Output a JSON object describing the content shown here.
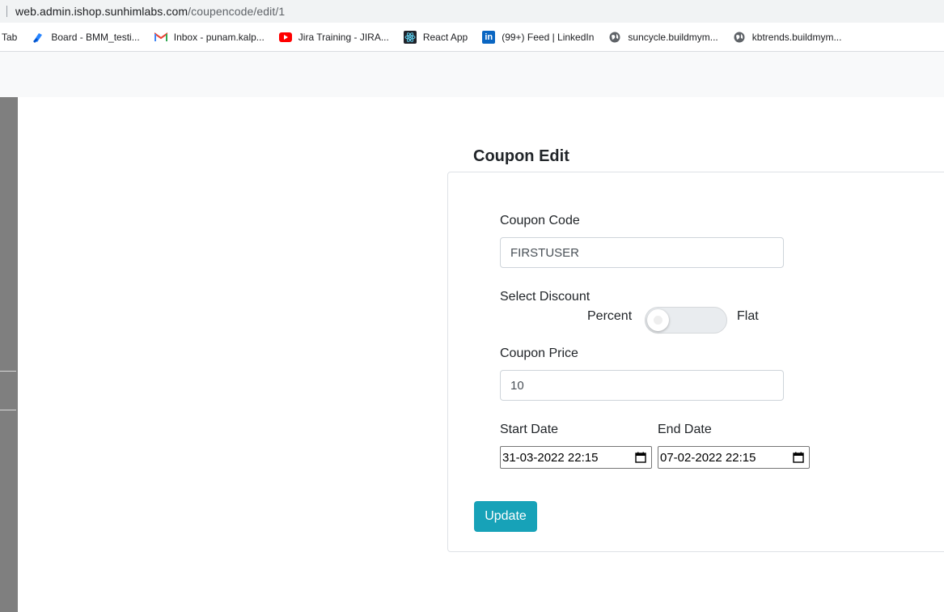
{
  "browser": {
    "url_host": "web.admin.ishop.sunhimlabs.com",
    "url_path": "/coupencode/edit/1"
  },
  "bookmarks": [
    {
      "label": "Tab",
      "icon": "none"
    },
    {
      "label": "Board - BMM_testi...",
      "icon": "board-icon"
    },
    {
      "label": "Inbox - punam.kalp...",
      "icon": "gmail-icon"
    },
    {
      "label": "Jira Training - JIRA...",
      "icon": "youtube-icon"
    },
    {
      "label": "React App",
      "icon": "react-icon"
    },
    {
      "label": "(99+) Feed | LinkedIn",
      "icon": "linkedin-icon"
    },
    {
      "label": "suncycle.buildmym...",
      "icon": "globe-icon"
    },
    {
      "label": "kbtrends.buildmym...",
      "icon": "globe-icon"
    }
  ],
  "form": {
    "title": "Coupon Edit",
    "coupon_code_label": "Coupon Code",
    "coupon_code_value": "FIRSTUSER",
    "discount_label": "Select Discount",
    "discount_left": "Percent",
    "discount_right": "Flat",
    "price_label": "Coupon Price",
    "price_value": "10",
    "start_label": "Start Date",
    "start_value": "31-03-2022 22:15",
    "end_label": "End Date",
    "end_value": "07-02-2022 22:15",
    "submit_label": "Update"
  },
  "colors": {
    "accent": "#17a2b8",
    "sidebar": "#7f7f7f"
  }
}
